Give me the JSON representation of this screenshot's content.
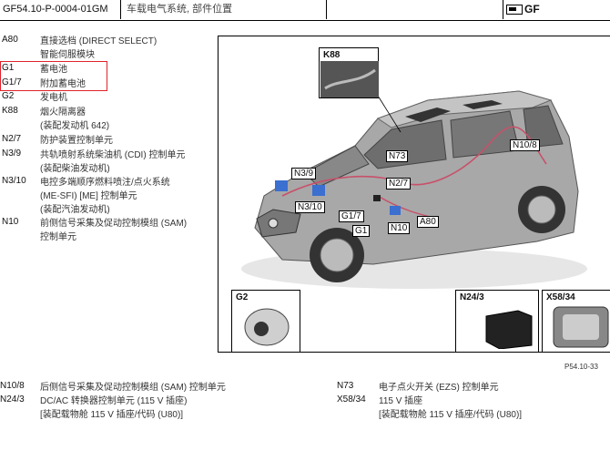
{
  "header": {
    "doc_id": "GF54.10-P-0004-01GM",
    "title": "车载电气系统, 部件位置",
    "logo_text": "GF"
  },
  "legend": [
    {
      "code": "A80",
      "lines": [
        "直接选档 (DIRECT SELECT)",
        "智能伺服模块"
      ]
    },
    {
      "code": "G1",
      "lines": [
        "蓄电池"
      ]
    },
    {
      "code": "G1/7",
      "lines": [
        "附加蓄电池"
      ]
    },
    {
      "code": "G2",
      "lines": [
        "发电机"
      ]
    },
    {
      "code": "K88",
      "lines": [
        "烟火隔离器",
        "(装配发动机 642)"
      ]
    },
    {
      "code": "N2/7",
      "lines": [
        "防护装置控制单元"
      ]
    },
    {
      "code": "N3/9",
      "lines": [
        "共轨喷射系统柴油机 (CDI) 控制单元",
        "(装配柴油发动机)"
      ]
    },
    {
      "code": "N3/10",
      "lines": [
        "电控多端顺序燃料喷注/点火系统",
        "(ME-SFI) [ME] 控制单元",
        "(装配汽油发动机)"
      ]
    },
    {
      "code": "N10",
      "lines": [
        "前侧信号采集及促动控制模组 (SAM)",
        "控制单元"
      ]
    }
  ],
  "figure": {
    "callouts": {
      "k88": "K88",
      "n10_8": "N10/8",
      "n73": "N73",
      "n3_9": "N3/9",
      "n2_7": "N2/7",
      "n3_10": "N3/10",
      "g1_7": "G1/7",
      "n10": "N10",
      "a80": "A80",
      "g1": "G1"
    },
    "insets": {
      "g2": "G2",
      "n24_3": "N24/3",
      "x58_34": "X58/34"
    },
    "ref": "P54.10-33"
  },
  "bottom_left": [
    {
      "code": "N10/8",
      "lines": [
        "后侧信号采集及促动控制模组 (SAM) 控制单元"
      ]
    },
    {
      "code": "N24/3",
      "lines": [
        "DC/AC 转换器控制单元 (115 V 插座)",
        "[装配载物舱 115 V 插座/代码 (U80)]"
      ]
    }
  ],
  "bottom_right": [
    {
      "code": "N73",
      "lines": [
        "电子点火开关 (EZS) 控制单元"
      ]
    },
    {
      "code": "X58/34",
      "lines": [
        "115 V 插座",
        "[装配载物舱 115 V 插座/代码 (U80)]"
      ]
    }
  ],
  "colors": {
    "highlight": "#e0232a",
    "car_body": "#9a9a9a",
    "wiring": "#c8506a",
    "module": "#3b6fd0"
  }
}
